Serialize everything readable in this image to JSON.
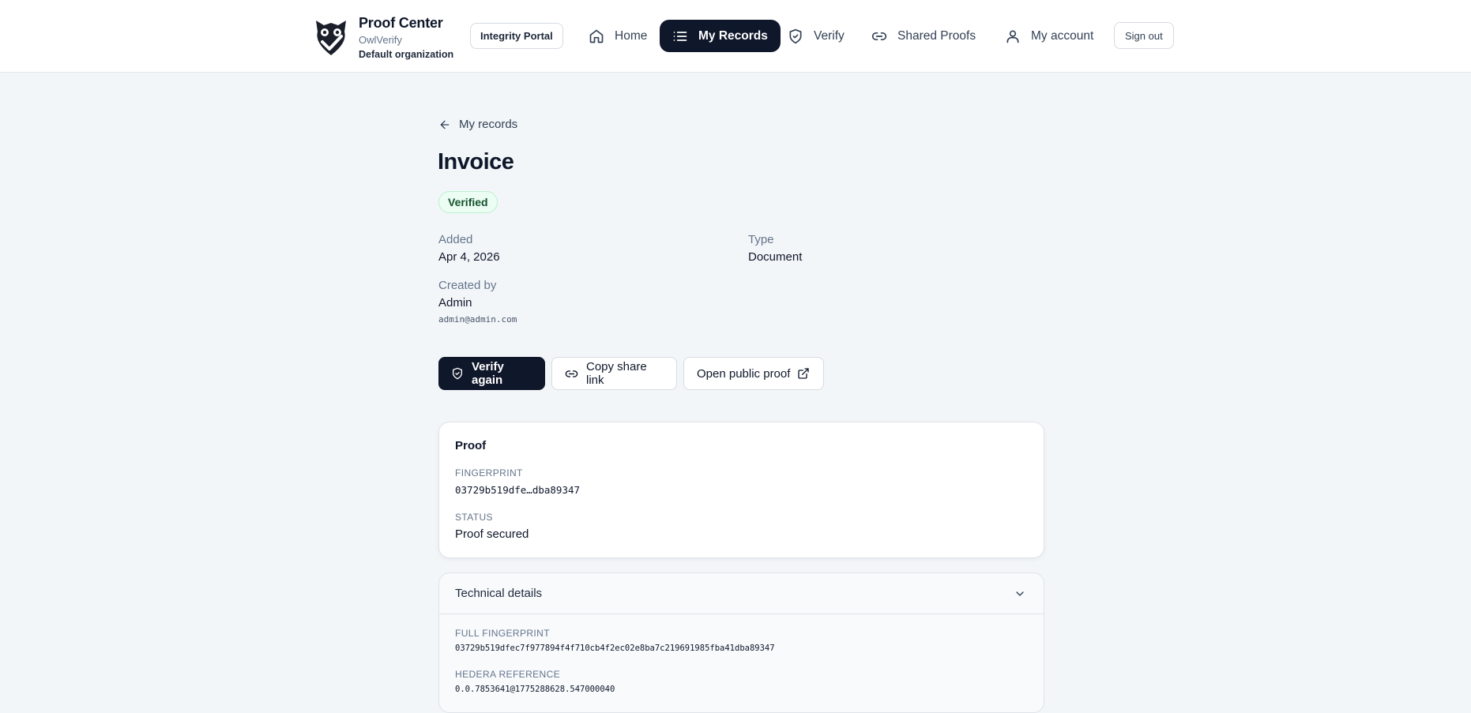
{
  "header": {
    "brand_title": "Proof Center",
    "brand_sub": "OwlVerify",
    "brand_org": "Default organization",
    "portal_label": "Integrity Portal",
    "nav": [
      {
        "label": "Home",
        "icon": "home-icon"
      },
      {
        "label": "My Records",
        "icon": "list-icon",
        "active": true
      },
      {
        "label": "Verify",
        "icon": "shield-check-icon"
      },
      {
        "label": "Shared Proofs",
        "icon": "link-icon"
      },
      {
        "label": "My account",
        "icon": "user-icon"
      }
    ],
    "signout_label": "Sign out"
  },
  "breadcrumb": {
    "back_label": "My records"
  },
  "record": {
    "title": "Invoice",
    "status": "Verified",
    "added_label": "Added",
    "added_value": "Apr 4, 2026",
    "type_label": "Type",
    "type_value": "Document",
    "created_by_label": "Created by",
    "created_by_name": "Admin",
    "created_by_email": "admin@admin.com"
  },
  "actions": {
    "verify_again": "Verify again",
    "copy_share_link": "Copy share link",
    "open_public_proof": "Open public proof"
  },
  "proof": {
    "title": "Proof",
    "fingerprint_label": "FINGERPRINT",
    "fingerprint_value": "03729b519dfe…dba89347",
    "status_label": "STATUS",
    "status_value": "Proof secured"
  },
  "technical": {
    "title": "Technical details",
    "full_fingerprint_label": "FULL FINGERPRINT",
    "full_fingerprint_value": "03729b519dfec7f977894f4f710cb4f2ec02e8ba7c219691985fba41dba89347",
    "hedera_label": "HEDERA REFERENCE",
    "hedera_value": "0.0.7853641@1775288628.547000040"
  },
  "colors": {
    "primary": "#0f172a",
    "page_bg": "#f3f6f9",
    "badge_bg": "#ecfdf3",
    "badge_text": "#14532d"
  }
}
